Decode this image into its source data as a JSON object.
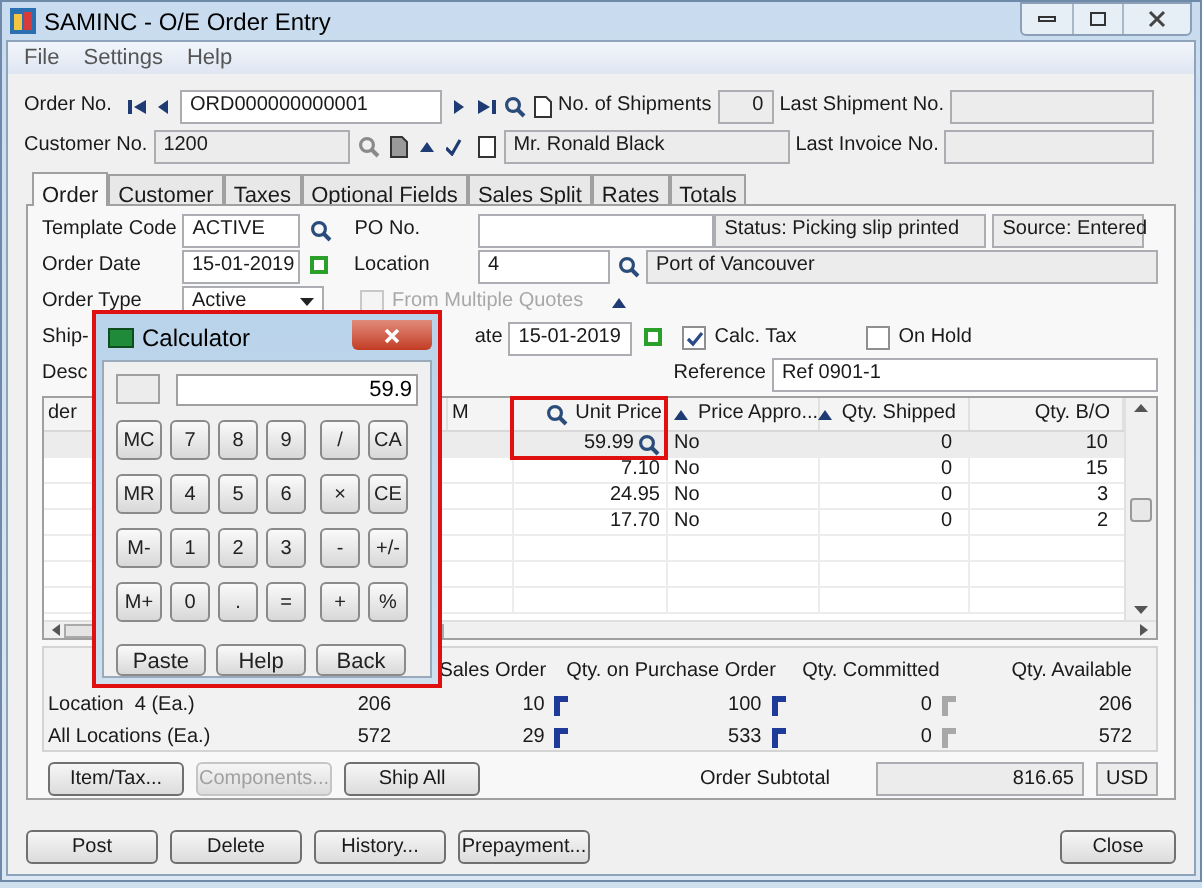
{
  "window": {
    "title": "SAMINC - O/E Order Entry"
  },
  "menu": [
    "File",
    "Settings",
    "Help"
  ],
  "header": {
    "order_no_label": "Order No.",
    "order_no": "ORD000000000001",
    "shipments_label": "No. of Shipments",
    "shipments": "0",
    "last_shipment_label": "Last Shipment No.",
    "customer_no_label": "Customer No.",
    "customer_no": "1200",
    "customer_name": "Mr. Ronald Black",
    "last_invoice_label": "Last Invoice No."
  },
  "tabs": [
    {
      "label": "Order",
      "selected": true
    },
    {
      "label": "Customer",
      "selected": false
    },
    {
      "label": "Taxes",
      "selected": false
    },
    {
      "label": "Optional Fields",
      "selected": false
    },
    {
      "label": "Sales Split",
      "selected": false
    },
    {
      "label": "Rates",
      "selected": false
    },
    {
      "label": "Totals",
      "selected": false
    }
  ],
  "order": {
    "template_label": "Template Code",
    "template": "ACTIVE",
    "po_label": "PO No.",
    "status": "Status: Picking slip printed",
    "source": "Source: Entered",
    "date_label": "Order Date",
    "date": "15-01-2019",
    "location_label": "Location",
    "location": "4",
    "location_name": "Port of Vancouver",
    "type_label": "Order Type",
    "type": "Active",
    "quotes": {
      "label": "From Multiple Quotes",
      "checked": false,
      "disabled": true
    },
    "ship_label": "Ship-",
    "ship_date_label": "ate",
    "ship_date": "15-01-2019",
    "calc_tax": {
      "label": "Calc. Tax",
      "checked": true,
      "disabled": false
    },
    "on_hold": {
      "label": "On Hold",
      "checked": false,
      "disabled": false
    },
    "desc_label": "Desc",
    "reference_label": "Reference",
    "reference": "Ref 0901-1"
  },
  "grid": {
    "columns": [
      {
        "label": "der",
        "kind": "plain",
        "highlighted": false
      },
      {
        "label": "M",
        "kind": "plain",
        "highlighted": false
      },
      {
        "label": "Unit Price",
        "kind": "search",
        "highlighted": true
      },
      {
        "label": "Price Appro...",
        "kind": "sort",
        "highlighted": false
      },
      {
        "label": "Qty. Shipped",
        "kind": "sort",
        "highlighted": false
      },
      {
        "label": "Qty. B/O",
        "kind": "plain",
        "highlighted": false
      }
    ],
    "rows": [
      {
        "unit_price": "59.99",
        "price_approved": "No",
        "qty_shipped": "0",
        "qty_bo": "10",
        "selected": true
      },
      {
        "unit_price": "7.10",
        "price_approved": "No",
        "qty_shipped": "0",
        "qty_bo": "15",
        "selected": false
      },
      {
        "unit_price": "24.95",
        "price_approved": "No",
        "qty_shipped": "0",
        "qty_bo": "3",
        "selected": false
      },
      {
        "unit_price": "17.70",
        "price_approved": "No",
        "qty_shipped": "0",
        "qty_bo": "2",
        "selected": false
      }
    ]
  },
  "inventory": {
    "columns": [
      {
        "label": "Sales Order",
        "drilldown_enabled": true
      },
      {
        "label": "Qty. on Purchase Order",
        "drilldown_enabled": true
      },
      {
        "label": "Qty. Committed",
        "drilldown_enabled": false
      },
      {
        "label": "Qty. Available"
      }
    ],
    "rows": [
      {
        "label": "Location  4 (Ea.)",
        "on_hand": "206",
        "values": [
          "10",
          "100",
          "0",
          "206"
        ]
      },
      {
        "label": "All Locations (Ea.)",
        "on_hand": "572",
        "values": [
          "29",
          "533",
          "0",
          "572"
        ]
      }
    ]
  },
  "actions": [
    {
      "label": "Item/Tax...",
      "disabled": false
    },
    {
      "label": "Components...",
      "disabled": true
    },
    {
      "label": "Ship All",
      "disabled": false
    }
  ],
  "subtotal": {
    "label": "Order Subtotal",
    "value": "816.65",
    "currency": "USD"
  },
  "footer_buttons": [
    "Post",
    "Delete",
    "History...",
    "Prepayment..."
  ],
  "close_button": "Close",
  "calculator": {
    "title": "Calculator",
    "display": "59.9",
    "keys": [
      [
        "MC",
        "7",
        "8",
        "9",
        "/",
        "CA"
      ],
      [
        "MR",
        "4",
        "5",
        "6",
        "×",
        "CE"
      ],
      [
        "M-",
        "1",
        "2",
        "3",
        "-",
        "+/-"
      ],
      [
        "M+",
        "0",
        ".",
        "=",
        "+",
        "%"
      ]
    ],
    "actions": [
      "Paste",
      "Help",
      "Back"
    ]
  }
}
